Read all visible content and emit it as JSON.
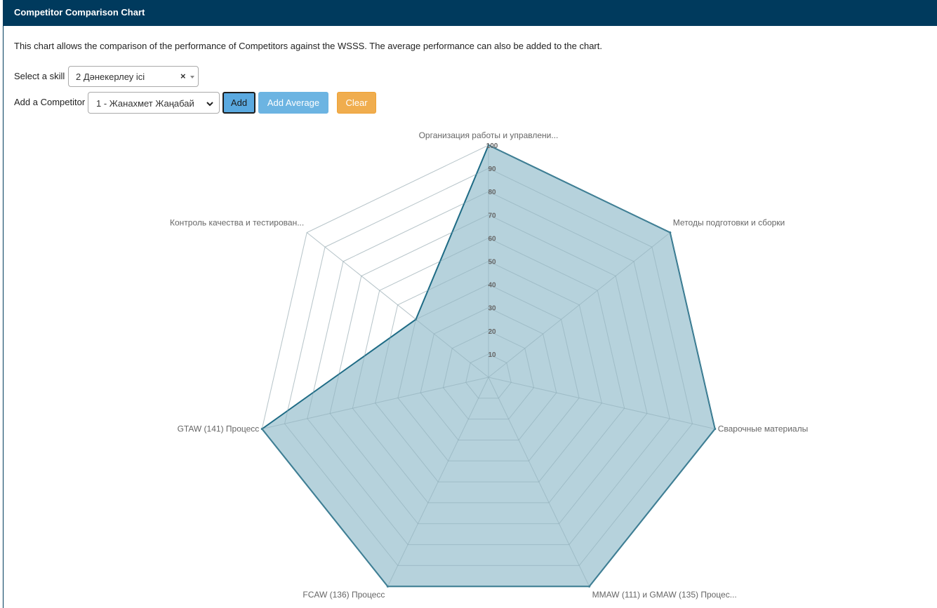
{
  "header": {
    "title": "Competitor Comparison Chart"
  },
  "description": "This chart allows the comparison of the performance of Competitors against the WSSS. The average performance can also be added to the chart.",
  "skill": {
    "label": "Select a skill",
    "value": "2 Дәнекерлеу ісі",
    "clear_symbol": "×"
  },
  "competitor": {
    "label": "Add a Competitor",
    "value": "1 - Жанахмет Жаңабай"
  },
  "buttons": {
    "add": "Add",
    "add_average": "Add Average",
    "clear": "Clear"
  },
  "colors": {
    "header": "#003a5d",
    "series_fill": "#a9cad6",
    "series_stroke": "#1e6b85",
    "button_blue": "#6cb4e2",
    "button_orange": "#f0ad4e"
  },
  "chart_data": {
    "type": "radar",
    "axes": [
      "Организация работы и управлени...",
      "Методы подготовки и сборки",
      "Сварочные материалы",
      "MMAW (111) и GMAW (135) Процес...",
      "FCAW (136) Процесс",
      "GTAW (141) Процесс",
      "Контроль качества и тестирован..."
    ],
    "ticks": [
      "10",
      "20",
      "30",
      "40",
      "50",
      "60",
      "70",
      "80",
      "90",
      "100"
    ],
    "range": [
      0,
      100
    ],
    "series": [
      {
        "values": [
          100,
          100,
          100,
          100,
          100,
          100,
          40
        ]
      }
    ]
  }
}
